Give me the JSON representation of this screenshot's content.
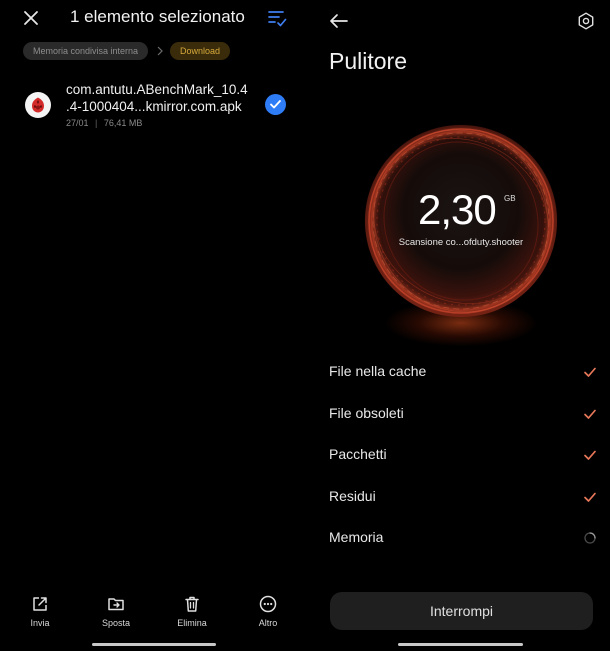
{
  "left": {
    "title": "1 elemento selezionato",
    "breadcrumb": [
      "Memoria condivisa interna",
      "Download"
    ],
    "file": {
      "name_line1": "com.antutu.ABenchMark_10.4",
      "name_line2": ".4-1000404...kmirror.com.apk",
      "date": "27/01",
      "separator": "|",
      "size": "76,41 MB",
      "selected": true
    },
    "toolbar": {
      "share": "Invia",
      "move": "Sposta",
      "delete": "Elimina",
      "more": "Altro"
    }
  },
  "right": {
    "title": "Pulitore",
    "scan": {
      "size_value": "2,30",
      "size_unit": "GB",
      "status": "Scansione co...ofduty.shooter"
    },
    "items": [
      {
        "label": "File nella cache",
        "state": "done"
      },
      {
        "label": "File obsoleti",
        "state": "done"
      },
      {
        "label": "Pacchetti",
        "state": "done"
      },
      {
        "label": "Residui",
        "state": "done"
      },
      {
        "label": "Memoria",
        "state": "scanning"
      }
    ],
    "stop_label": "Interrompi"
  },
  "colors": {
    "accent_blue": "#2f7df6",
    "check_orange": "#e8785a",
    "folder_chip_text": "#d6a93a",
    "orb_red": "#c2432a"
  },
  "icons": {
    "close": "close-icon",
    "select_all": "select-all-icon",
    "share": "share-icon",
    "move": "move-icon",
    "delete": "trash-icon",
    "more": "more-icon",
    "back": "back-arrow-icon",
    "settings": "settings-icon",
    "check": "check-icon",
    "spinner": "spinner-icon"
  }
}
